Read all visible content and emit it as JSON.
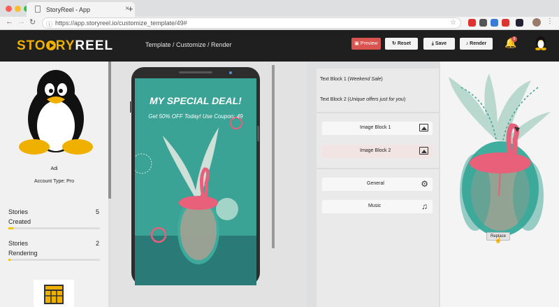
{
  "browser": {
    "tab_title": "StoryReel - App",
    "url": "https://app.storyreel.io/customize_template/49#",
    "new_tab_symbol": "+",
    "ext_colors": [
      "#d33",
      "#555",
      "#3a7bd5",
      "#d33",
      "#223"
    ]
  },
  "header": {
    "logo_part1": "STO",
    "logo_part2": "RY",
    "logo_part3": "REEL",
    "breadcrumb": "Template  /  Customize  /  Render",
    "preview_label": "Preview",
    "reset_label": "Reset",
    "save_label": "Save",
    "render_label": "Render",
    "notification_count": "9"
  },
  "sidebar": {
    "username": "Adi",
    "account_type": "Account Type: Pro",
    "stats": [
      {
        "label_line1": "Stories",
        "label_line2": "Created",
        "value": "5",
        "progress": 0.05
      },
      {
        "label_line1": "Stories",
        "label_line2": "Rendering",
        "value": "2",
        "progress": 0.02
      }
    ]
  },
  "template": {
    "headline": "MY SPECIAL DEAL!",
    "subline": "Get 50% OFF Today! Use Coupon: 49"
  },
  "editor": {
    "text_block_1_prefix": "Text Block 1 (",
    "text_block_1_value": "Weekend Sale",
    "text_block_2_prefix": "Text Block 2 (",
    "text_block_2_value": "Unique offers just for you",
    "suffix": ")",
    "image_block_1": "Image Block 1",
    "image_block_2": "Image Block 2",
    "general": "General",
    "music": "Music"
  },
  "preview_panel": {
    "replace_label": "Replace"
  },
  "colors": {
    "accent_red": "#d9534f",
    "teal": "#3aa396",
    "pink": "#e8607a",
    "yellow": "#f0b000"
  }
}
